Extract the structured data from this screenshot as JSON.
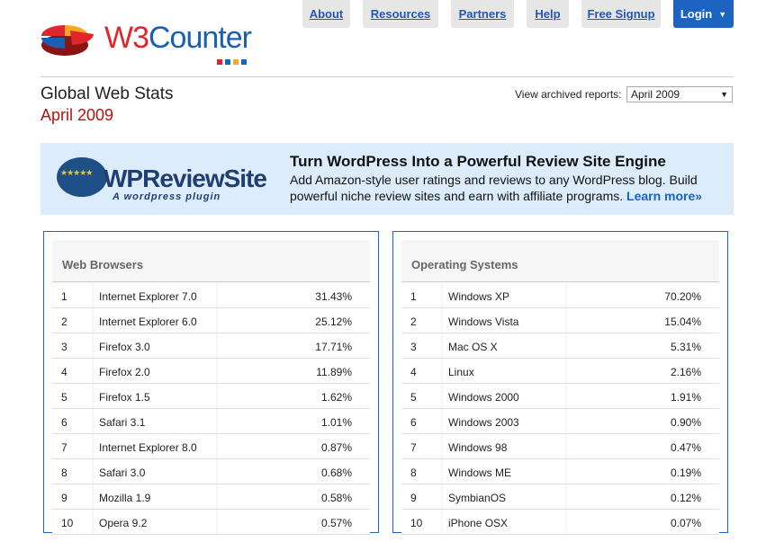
{
  "logo": {
    "text_w3": "W3",
    "text_counter": "Counter",
    "squares": [
      "#e0262c",
      "#1c63c2",
      "#f5a623",
      "#1c63c2"
    ]
  },
  "nav": {
    "items": [
      {
        "label": "About"
      },
      {
        "label": "Resources"
      },
      {
        "label": "Partners"
      },
      {
        "label": "Help"
      },
      {
        "label": "Free Signup"
      }
    ],
    "login": "Login"
  },
  "header": {
    "title": "Global Web Stats",
    "subtitle": "April 2009",
    "archive_label": "View archived reports:",
    "archive_selected": "April 2009"
  },
  "banner": {
    "logo_name": "WPReviewSite",
    "logo_tag": "A wordpress plugin",
    "headline": "Turn WordPress Into a Powerful Review Site Engine",
    "body": "Add Amazon-style user ratings and reviews to any WordPress blog. Build powerful niche review sites and earn with affiliate programs.",
    "link": "Learn more»"
  },
  "browsers": {
    "title": "Web Browsers",
    "rows": [
      {
        "rank": "1",
        "name": "Internet Explorer 7.0",
        "pct": "31.43%"
      },
      {
        "rank": "2",
        "name": "Internet Explorer 6.0",
        "pct": "25.12%"
      },
      {
        "rank": "3",
        "name": "Firefox 3.0",
        "pct": "17.71%"
      },
      {
        "rank": "4",
        "name": "Firefox 2.0",
        "pct": "11.89%"
      },
      {
        "rank": "5",
        "name": "Firefox 1.5",
        "pct": "1.62%"
      },
      {
        "rank": "6",
        "name": "Safari 3.1",
        "pct": "1.01%"
      },
      {
        "rank": "7",
        "name": "Internet Explorer 8.0",
        "pct": "0.87%"
      },
      {
        "rank": "8",
        "name": "Safari 3.0",
        "pct": "0.68%"
      },
      {
        "rank": "9",
        "name": "Mozilla 1.9",
        "pct": "0.58%"
      },
      {
        "rank": "10",
        "name": "Opera 9.2",
        "pct": "0.57%"
      }
    ]
  },
  "os": {
    "title": "Operating Systems",
    "rows": [
      {
        "rank": "1",
        "name": "Windows XP",
        "pct": "70.20%"
      },
      {
        "rank": "2",
        "name": "Windows Vista",
        "pct": "15.04%"
      },
      {
        "rank": "3",
        "name": "Mac OS X",
        "pct": "5.31%"
      },
      {
        "rank": "4",
        "name": "Linux",
        "pct": "2.16%"
      },
      {
        "rank": "5",
        "name": "Windows 2000",
        "pct": "1.91%"
      },
      {
        "rank": "6",
        "name": "Windows 2003",
        "pct": "0.90%"
      },
      {
        "rank": "7",
        "name": "Windows 98",
        "pct": "0.47%"
      },
      {
        "rank": "8",
        "name": "Windows ME",
        "pct": "0.19%"
      },
      {
        "rank": "9",
        "name": "SymbianOS",
        "pct": "0.12%"
      },
      {
        "rank": "10",
        "name": "iPhone OSX",
        "pct": "0.07%"
      }
    ]
  }
}
